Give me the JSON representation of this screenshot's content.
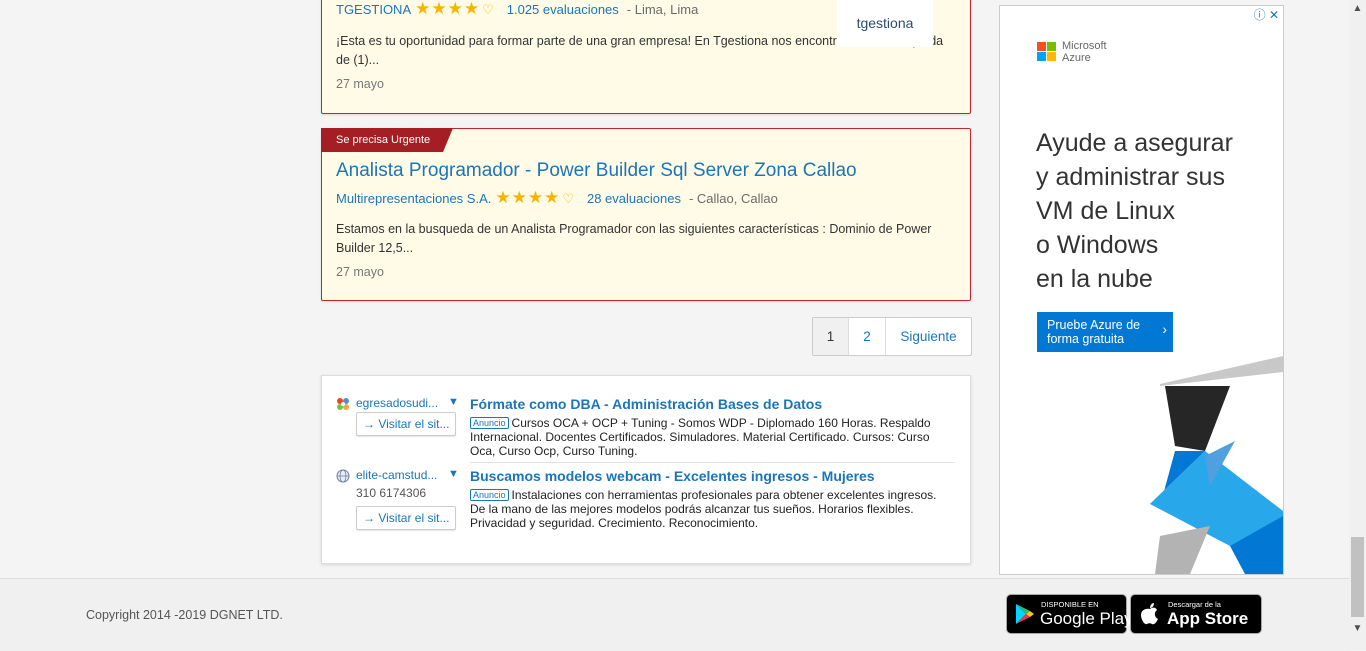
{
  "jobs": [
    {
      "company": "TGESTIONA",
      "evaluations": "1.025 evaluaciones",
      "location": "- Lima, Lima",
      "description": "¡Esta es tu oportunidad para formar parte de una gran empresa! En Tgestiona nos encontramos en búsqueda de (1)...",
      "date": "27 mayo",
      "logo_text": "tgestiona",
      "rating": 4
    },
    {
      "badge": "Se precisa Urgente",
      "title": "Analista Programador - Power Builder Sql Server Zona Callao",
      "company": "Multirepresentaciones S.A.",
      "evaluations": "28 evaluaciones",
      "location": "- Callao, Callao",
      "description": "Estamos en la busqueda de un Analista Programador con las siguientes características : Dominio de Power Builder 12,5...",
      "date": "27 mayo",
      "rating": 4
    }
  ],
  "pagination": {
    "pages": [
      "1",
      "2"
    ],
    "next": "Siguiente",
    "current": "1"
  },
  "ads": [
    {
      "site": "egresadosudi...",
      "visit": "Visitar el sit...",
      "title": "Fórmate como DBA - Administración Bases de Datos",
      "label": "Anuncio",
      "text": "Cursos OCA + OCP + Tuning - Somos WDP - Diplomado 160 Horas. Respaldo Internacional. Docentes Certificados. Simuladores. Material Certificado. Cursos: Curso Oca, Curso Ocp, Curso Tuning."
    },
    {
      "site": "elite-camstud...",
      "phone": "310 6174306",
      "visit": "Visitar el sit...",
      "title": "Buscamos modelos webcam - Excelentes ingresos - Mujeres",
      "label": "Anuncio",
      "text": "Instalaciones con herramientas profesionales para obtener excelentes ingresos. De la mano de las mejores modelos podrás alcanzar tus sueños. Horarios flexibles. Privacidad y seguridad. Crecimiento. Reconocimiento."
    }
  ],
  "side_ad": {
    "brand_line1": "Microsoft",
    "brand_line2": "Azure",
    "headline": [
      "Ayude a asegurar",
      "y administrar sus",
      "VM de Linux",
      "o Windows",
      "en la nube"
    ],
    "cta_line1": "Pruebe Azure de",
    "cta_line2": "forma gratuita"
  },
  "footer": {
    "copyright": "Copyright 2014 -2019 DGNET LTD.",
    "google_small": "DISPONIBLE EN",
    "google_big": "Google Play",
    "apple_small": "Descargar de la",
    "apple_big": "App Store"
  },
  "colors": {
    "accent": "#1a75bb",
    "urgent": "#a51e24",
    "star": "#f7b500",
    "card_bg": "#fffbe6",
    "azure": "#0078d4"
  }
}
